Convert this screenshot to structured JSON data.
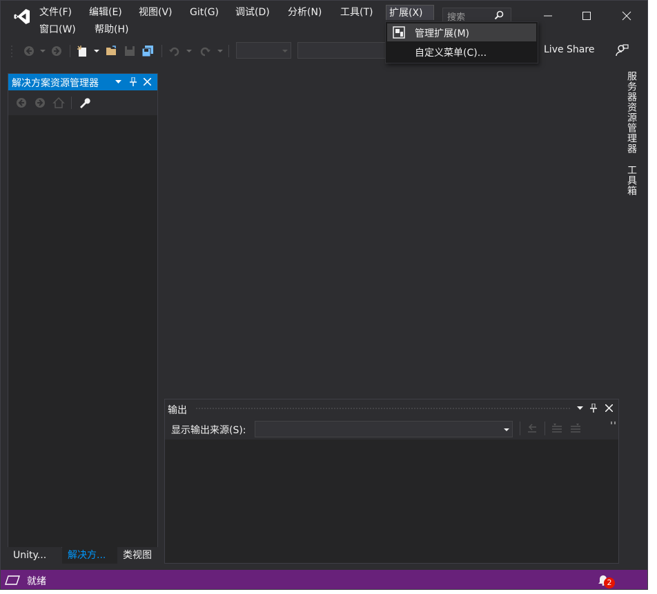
{
  "menu": {
    "file": "文件(F)",
    "edit": "编辑(E)",
    "view": "视图(V)",
    "git": "Git(G)",
    "debug": "调试(D)",
    "analyze": "分析(N)",
    "tools": "工具(T)",
    "extensions": "扩展(X)",
    "window": "窗口(W)",
    "help": "帮助(H)"
  },
  "search": {
    "placeholder": "搜索"
  },
  "extensions_menu": {
    "items": [
      {
        "label": "管理扩展(M)",
        "icon": "extension-manager-icon"
      },
      {
        "label": "自定义菜单(C)..."
      }
    ]
  },
  "toolbar": {
    "live_share": "Live Share"
  },
  "solution_explorer": {
    "title": "解决方案资源管理器"
  },
  "bottom_tabs": [
    "Unity...",
    "解决方...",
    "类视图"
  ],
  "output": {
    "title": "输出",
    "source_label": "显示输出来源(S):"
  },
  "side_tabs": [
    "服务器资源管理器",
    "工具箱"
  ],
  "status": {
    "text": "就绪",
    "notifications": "2"
  },
  "colors": {
    "accent": "#007acc",
    "status_bar": "#68217a",
    "vs_logo": "#ffffff",
    "folder": "#dcb67a",
    "save_blue": "#75beff",
    "badge": "#e51400"
  }
}
